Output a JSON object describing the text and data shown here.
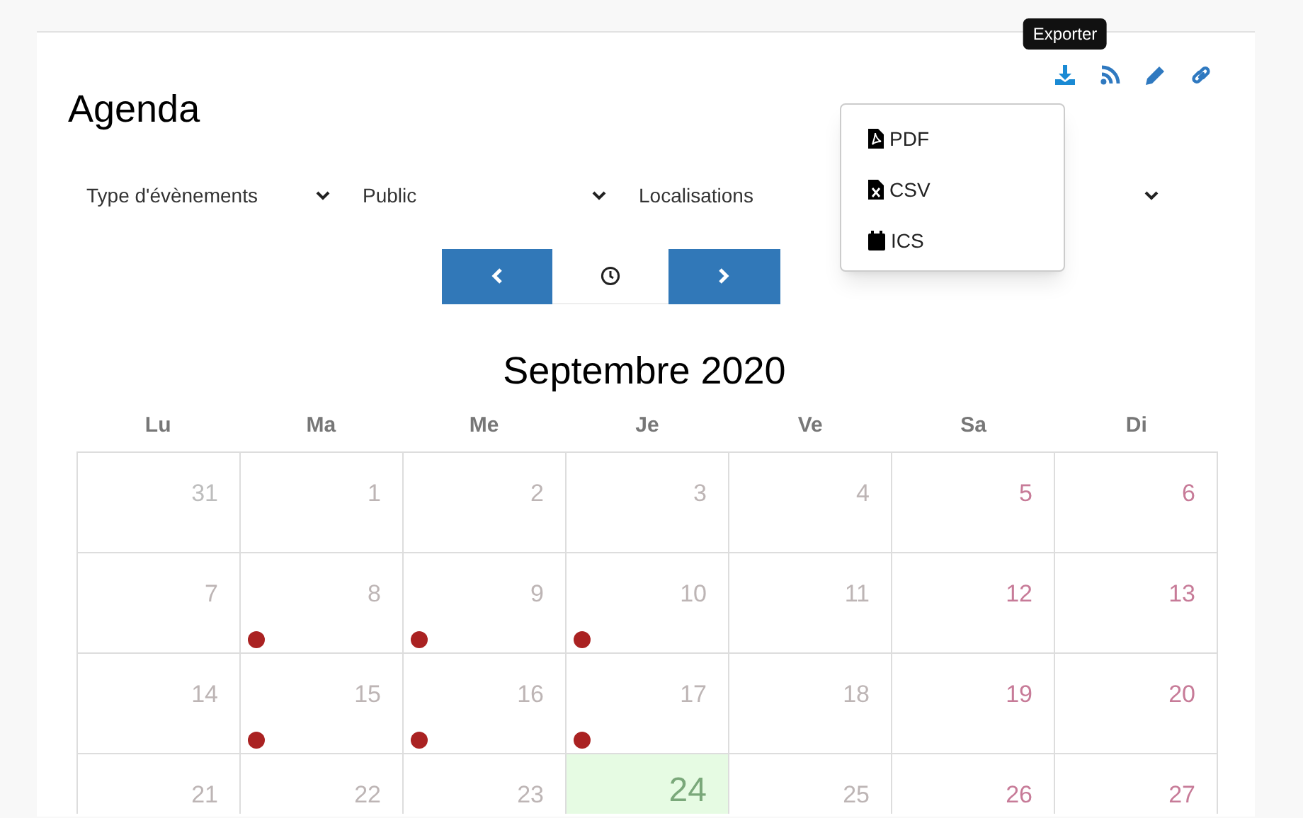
{
  "title": "Agenda",
  "toolbar": [
    {
      "kind": "download",
      "tooltip": "Exporter"
    },
    {
      "kind": "rss"
    },
    {
      "kind": "edit"
    },
    {
      "kind": "link"
    }
  ],
  "export_menu": [
    {
      "kind": "pdf",
      "label": "PDF"
    },
    {
      "kind": "csv",
      "label": "CSV"
    },
    {
      "kind": "calendar",
      "label": "ICS"
    }
  ],
  "filters": [
    {
      "kind": "select",
      "label": "Type d'évènements"
    },
    {
      "kind": "select",
      "label": "Public"
    },
    {
      "kind": "select",
      "label": "Localisations"
    },
    {
      "kind": "select"
    }
  ],
  "month": "Septembre 2020",
  "weekdays": [
    "Lu",
    "Ma",
    "Me",
    "Je",
    "Ve",
    "Sa",
    "Di"
  ],
  "days": [
    {
      "label": "31",
      "kind": "other",
      "event": false
    },
    {
      "label": "1",
      "kind": "weekday",
      "event": false
    },
    {
      "label": "2",
      "kind": "weekday",
      "event": false
    },
    {
      "label": "3",
      "kind": "weekday",
      "event": false
    },
    {
      "label": "4",
      "kind": "weekday",
      "event": false
    },
    {
      "label": "5",
      "kind": "weekend",
      "event": false
    },
    {
      "label": "6",
      "kind": "weekend",
      "event": false
    },
    {
      "label": "7",
      "kind": "weekday",
      "event": false
    },
    {
      "label": "8",
      "kind": "weekday",
      "event": true
    },
    {
      "label": "9",
      "kind": "weekday",
      "event": true
    },
    {
      "label": "10",
      "kind": "weekday",
      "event": true
    },
    {
      "label": "11",
      "kind": "weekday",
      "event": false
    },
    {
      "label": "12",
      "kind": "weekend",
      "event": false
    },
    {
      "label": "13",
      "kind": "weekend",
      "event": false
    },
    {
      "label": "14",
      "kind": "weekday",
      "event": false
    },
    {
      "label": "15",
      "kind": "weekday",
      "event": true
    },
    {
      "label": "16",
      "kind": "weekday",
      "event": true
    },
    {
      "label": "17",
      "kind": "weekday",
      "event": true
    },
    {
      "label": "18",
      "kind": "weekday",
      "event": false
    },
    {
      "label": "19",
      "kind": "weekend",
      "event": false
    },
    {
      "label": "20",
      "kind": "weekend",
      "event": false
    },
    {
      "label": "21",
      "kind": "weekday"
    },
    {
      "label": "22",
      "kind": "weekday"
    },
    {
      "label": "23",
      "kind": "weekday"
    },
    {
      "label": "24",
      "kind": "today"
    },
    {
      "label": "25",
      "kind": "weekday"
    },
    {
      "label": "26",
      "kind": "weekend"
    },
    {
      "label": "27",
      "kind": "weekend"
    }
  ]
}
